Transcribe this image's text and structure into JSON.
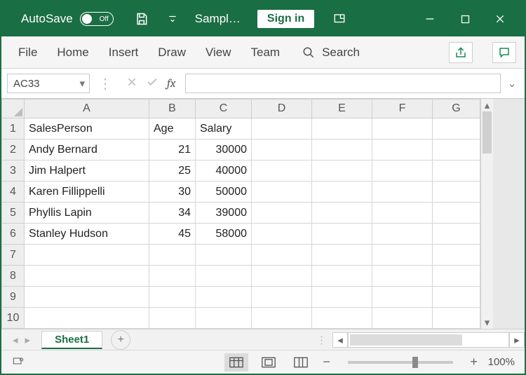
{
  "titlebar": {
    "autosave_label": "AutoSave",
    "autosave_state": "Off",
    "document_title": "Sampl…",
    "signin_label": "Sign in"
  },
  "ribbon": {
    "tabs": [
      "File",
      "Home",
      "Insert",
      "Draw",
      "View",
      "Team"
    ],
    "search_label": "Search"
  },
  "formula": {
    "namebox": "AC33",
    "fx_label": "fx",
    "value": ""
  },
  "grid": {
    "columns": [
      "A",
      "B",
      "C",
      "D",
      "E",
      "F",
      "G"
    ],
    "row_count": 10,
    "headers": {
      "A": "SalesPerson",
      "B": "Age",
      "C": "Salary"
    },
    "rows": [
      {
        "A": "Andy Bernard",
        "B": 21,
        "C": 30000
      },
      {
        "A": "Jim Halpert",
        "B": 25,
        "C": 40000
      },
      {
        "A": "Karen Fillippelli",
        "B": 30,
        "C": 50000
      },
      {
        "A": "Phyllis Lapin",
        "B": 34,
        "C": 39000
      },
      {
        "A": "Stanley Hudson",
        "B": 45,
        "C": 58000
      }
    ]
  },
  "sheet_tabs": {
    "active": "Sheet1"
  },
  "status": {
    "zoom": "100%"
  }
}
